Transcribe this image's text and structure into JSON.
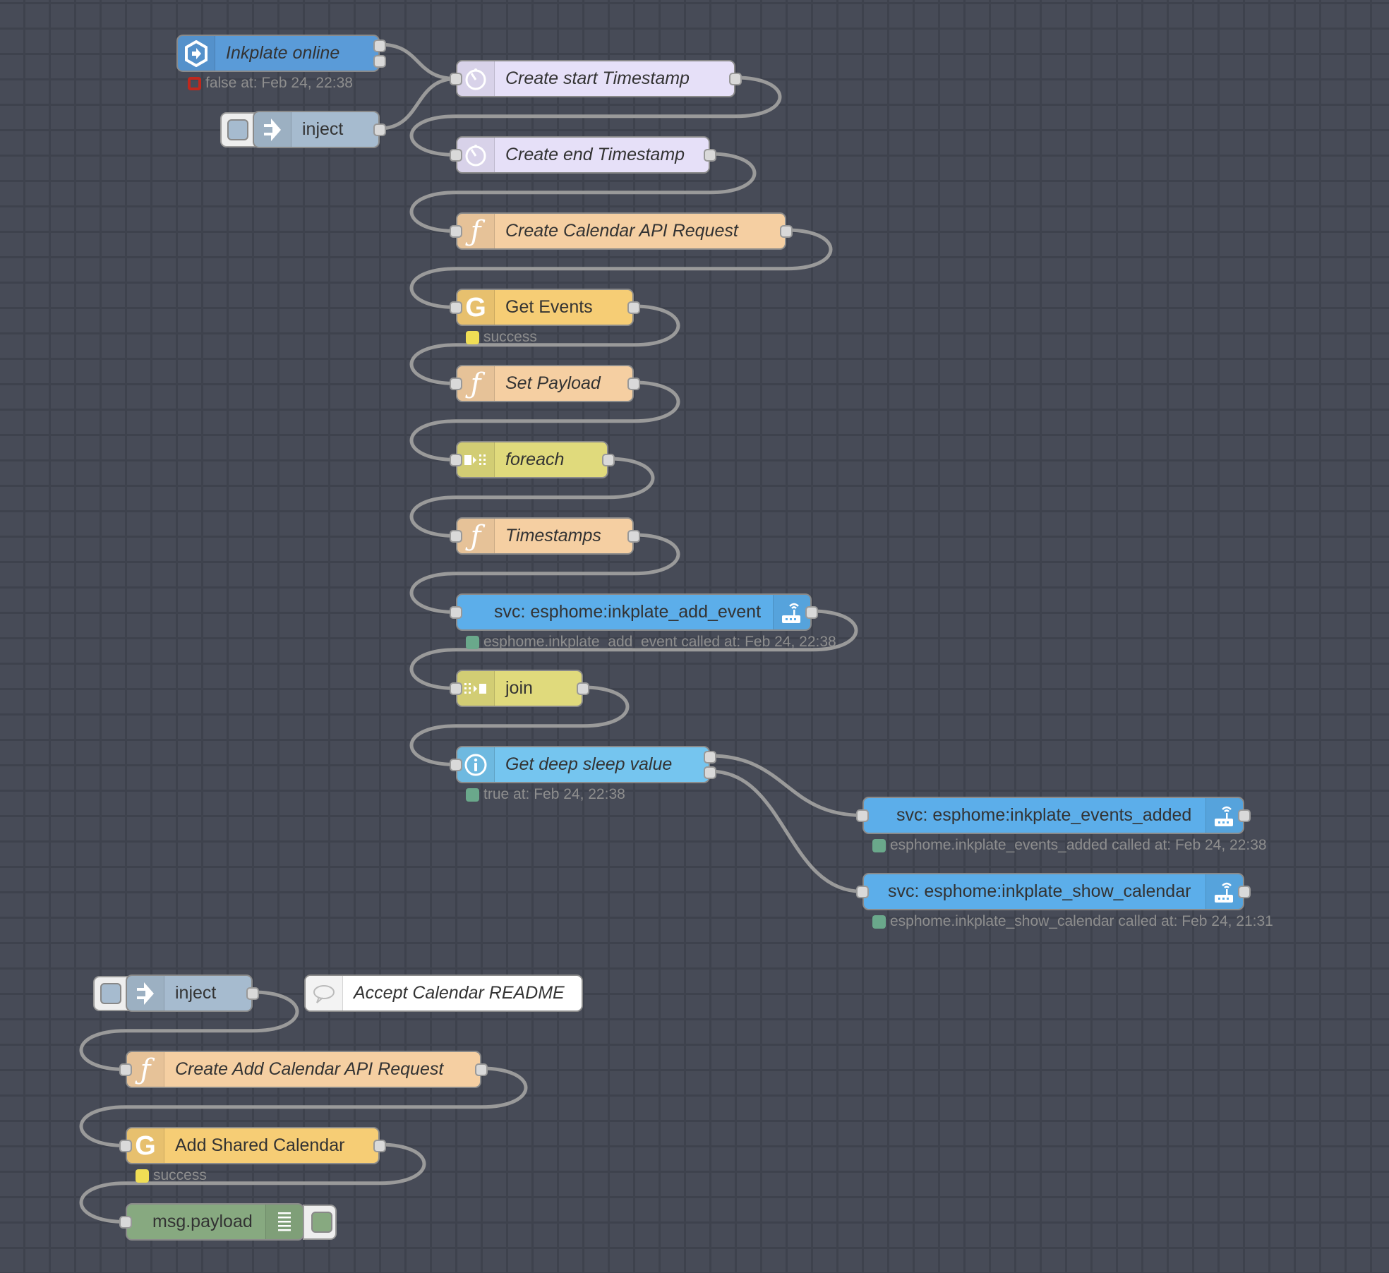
{
  "canvas": {
    "app": "Node-RED flow editor"
  },
  "colors": {
    "background": "#474b57",
    "grid": "#3e424d",
    "wire": "#9a9a9a",
    "ha_event": "#5a9bd8",
    "change_node": "#e6e0f8",
    "function": "#f5cfa2",
    "google": "#f6cd75",
    "split_join": "#e0da7c",
    "ha_service": "#5caeea",
    "ha_state": "#75c5ef",
    "inject": "#a6bbcf",
    "comment": "#ffffff",
    "debug": "#87a980",
    "status_red": "#c0281d",
    "status_yellow": "#f0de55",
    "status_green": "#6aa88b"
  },
  "nodes": [
    {
      "id": "n1",
      "label": "Inkplate online",
      "icon": "ha-event-icon",
      "italic": true,
      "status": {
        "color": "red",
        "shape": "ring",
        "text": "false at: Feb 24, 22:38"
      }
    },
    {
      "id": "n2",
      "label": "inject",
      "icon": "inject-arrow-icon",
      "italic": false
    },
    {
      "id": "n3",
      "label": "Create start Timestamp",
      "icon": "timer-icon",
      "italic": true
    },
    {
      "id": "n4",
      "label": "Create end Timestamp",
      "icon": "timer-icon",
      "italic": true
    },
    {
      "id": "n5",
      "label": "Create Calendar API Request",
      "icon": "function-icon",
      "italic": true
    },
    {
      "id": "n6",
      "label": "Get Events",
      "icon": "google-icon",
      "italic": false,
      "status": {
        "color": "yellow",
        "shape": "dot",
        "text": "success"
      }
    },
    {
      "id": "n7",
      "label": "Set Payload",
      "icon": "function-icon",
      "italic": true
    },
    {
      "id": "n8",
      "label": "foreach",
      "icon": "split-icon",
      "italic": true
    },
    {
      "id": "n9",
      "label": "Timestamps",
      "icon": "function-icon",
      "italic": true
    },
    {
      "id": "n10",
      "label": "svc: esphome:inkplate_add_event",
      "icon": "router-icon",
      "italic": false,
      "status": {
        "color": "green",
        "shape": "dot",
        "text": "esphome.inkplate_add_event called at: Feb 24, 22:38"
      }
    },
    {
      "id": "n11",
      "label": "join",
      "icon": "join-icon",
      "italic": false
    },
    {
      "id": "n12",
      "label": "Get deep sleep value",
      "icon": "info-icon",
      "italic": true,
      "status": {
        "color": "green",
        "shape": "dot",
        "text": "true at: Feb 24, 22:38"
      }
    },
    {
      "id": "n13",
      "label": "svc: esphome:inkplate_events_added",
      "icon": "router-icon",
      "italic": false,
      "status": {
        "color": "green",
        "shape": "dot",
        "text": "esphome.inkplate_events_added called at: Feb 24, 22:38"
      }
    },
    {
      "id": "n14",
      "label": "svc: esphome:inkplate_show_calendar",
      "icon": "router-icon",
      "italic": false,
      "status": {
        "color": "green",
        "shape": "dot",
        "text": "esphome.inkplate_show_calendar called at: Feb 24, 21:31"
      }
    },
    {
      "id": "n15",
      "label": "inject",
      "icon": "inject-arrow-icon",
      "italic": false
    },
    {
      "id": "n16",
      "label": "Accept Calendar README",
      "icon": "comment-icon",
      "italic": true
    },
    {
      "id": "n17",
      "label": "Create Add Calendar API Request",
      "icon": "function-icon",
      "italic": true
    },
    {
      "id": "n18",
      "label": "Add Shared Calendar",
      "icon": "google-icon",
      "italic": false,
      "status": {
        "color": "yellow",
        "shape": "dot",
        "text": "success"
      }
    },
    {
      "id": "n19",
      "label": "msg.payload",
      "icon": "debug-list-icon",
      "italic": false
    }
  ],
  "wires": [
    [
      "n1",
      0,
      "n3"
    ],
    [
      "n2",
      0,
      "n3"
    ],
    [
      "n3",
      0,
      "n4"
    ],
    [
      "n4",
      0,
      "n5"
    ],
    [
      "n5",
      0,
      "n6"
    ],
    [
      "n6",
      0,
      "n7"
    ],
    [
      "n7",
      0,
      "n8"
    ],
    [
      "n8",
      0,
      "n9"
    ],
    [
      "n9",
      0,
      "n10"
    ],
    [
      "n10",
      0,
      "n11"
    ],
    [
      "n11",
      0,
      "n12"
    ],
    [
      "n12",
      0,
      "n13"
    ],
    [
      "n12",
      1,
      "n14"
    ],
    [
      "n15",
      0,
      "n17"
    ],
    [
      "n17",
      0,
      "n18"
    ],
    [
      "n18",
      0,
      "n19"
    ]
  ]
}
